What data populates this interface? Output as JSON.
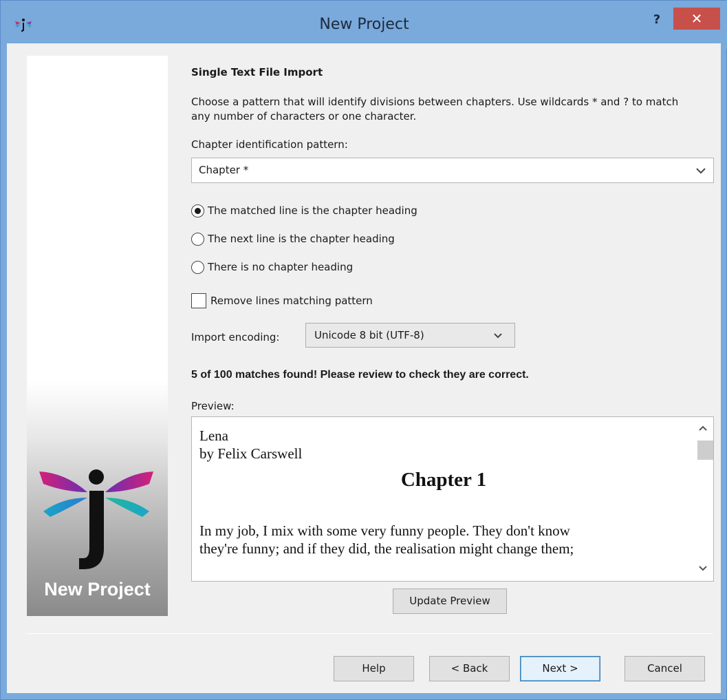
{
  "window": {
    "title": "New Project",
    "help_glyph": "?",
    "close_glyph": "✕"
  },
  "sidebar": {
    "caption": "New Project"
  },
  "main": {
    "heading": "Single Text File Import",
    "description": "Choose a pattern that will identify divisions between chapters. Use wildcards * and ? to match any number of characters or one character.",
    "pattern_label": "Chapter identification pattern:",
    "pattern_value": "Chapter *",
    "radios": [
      {
        "label": "The matched line is the chapter heading",
        "selected": true
      },
      {
        "label": "The next line is the chapter heading",
        "selected": false
      },
      {
        "label": "There is no chapter heading",
        "selected": false
      }
    ],
    "remove_lines_label": "Remove lines matching pattern",
    "remove_lines_checked": false,
    "encoding_label": "Import encoding:",
    "encoding_value": "Unicode 8 bit (UTF-8)",
    "matches_text": "5 of 100 matches found! Please review to check they are correct.",
    "preview_label": "Preview:",
    "preview": {
      "line1": "Lena",
      "line2": "by Felix Carswell",
      "chapter": "Chapter 1",
      "body1": "In my job, I mix with some very funny people. They don't know",
      "body2": "they're funny; and if they did, the realisation might change them;"
    },
    "update_preview_label": "Update Preview"
  },
  "footer": {
    "help": "Help",
    "back": "< Back",
    "next": "Next >",
    "cancel": "Cancel"
  },
  "colors": {
    "titlebar": "#7aa9dc",
    "close": "#c7504a",
    "dialog": "#f0f0f0"
  }
}
